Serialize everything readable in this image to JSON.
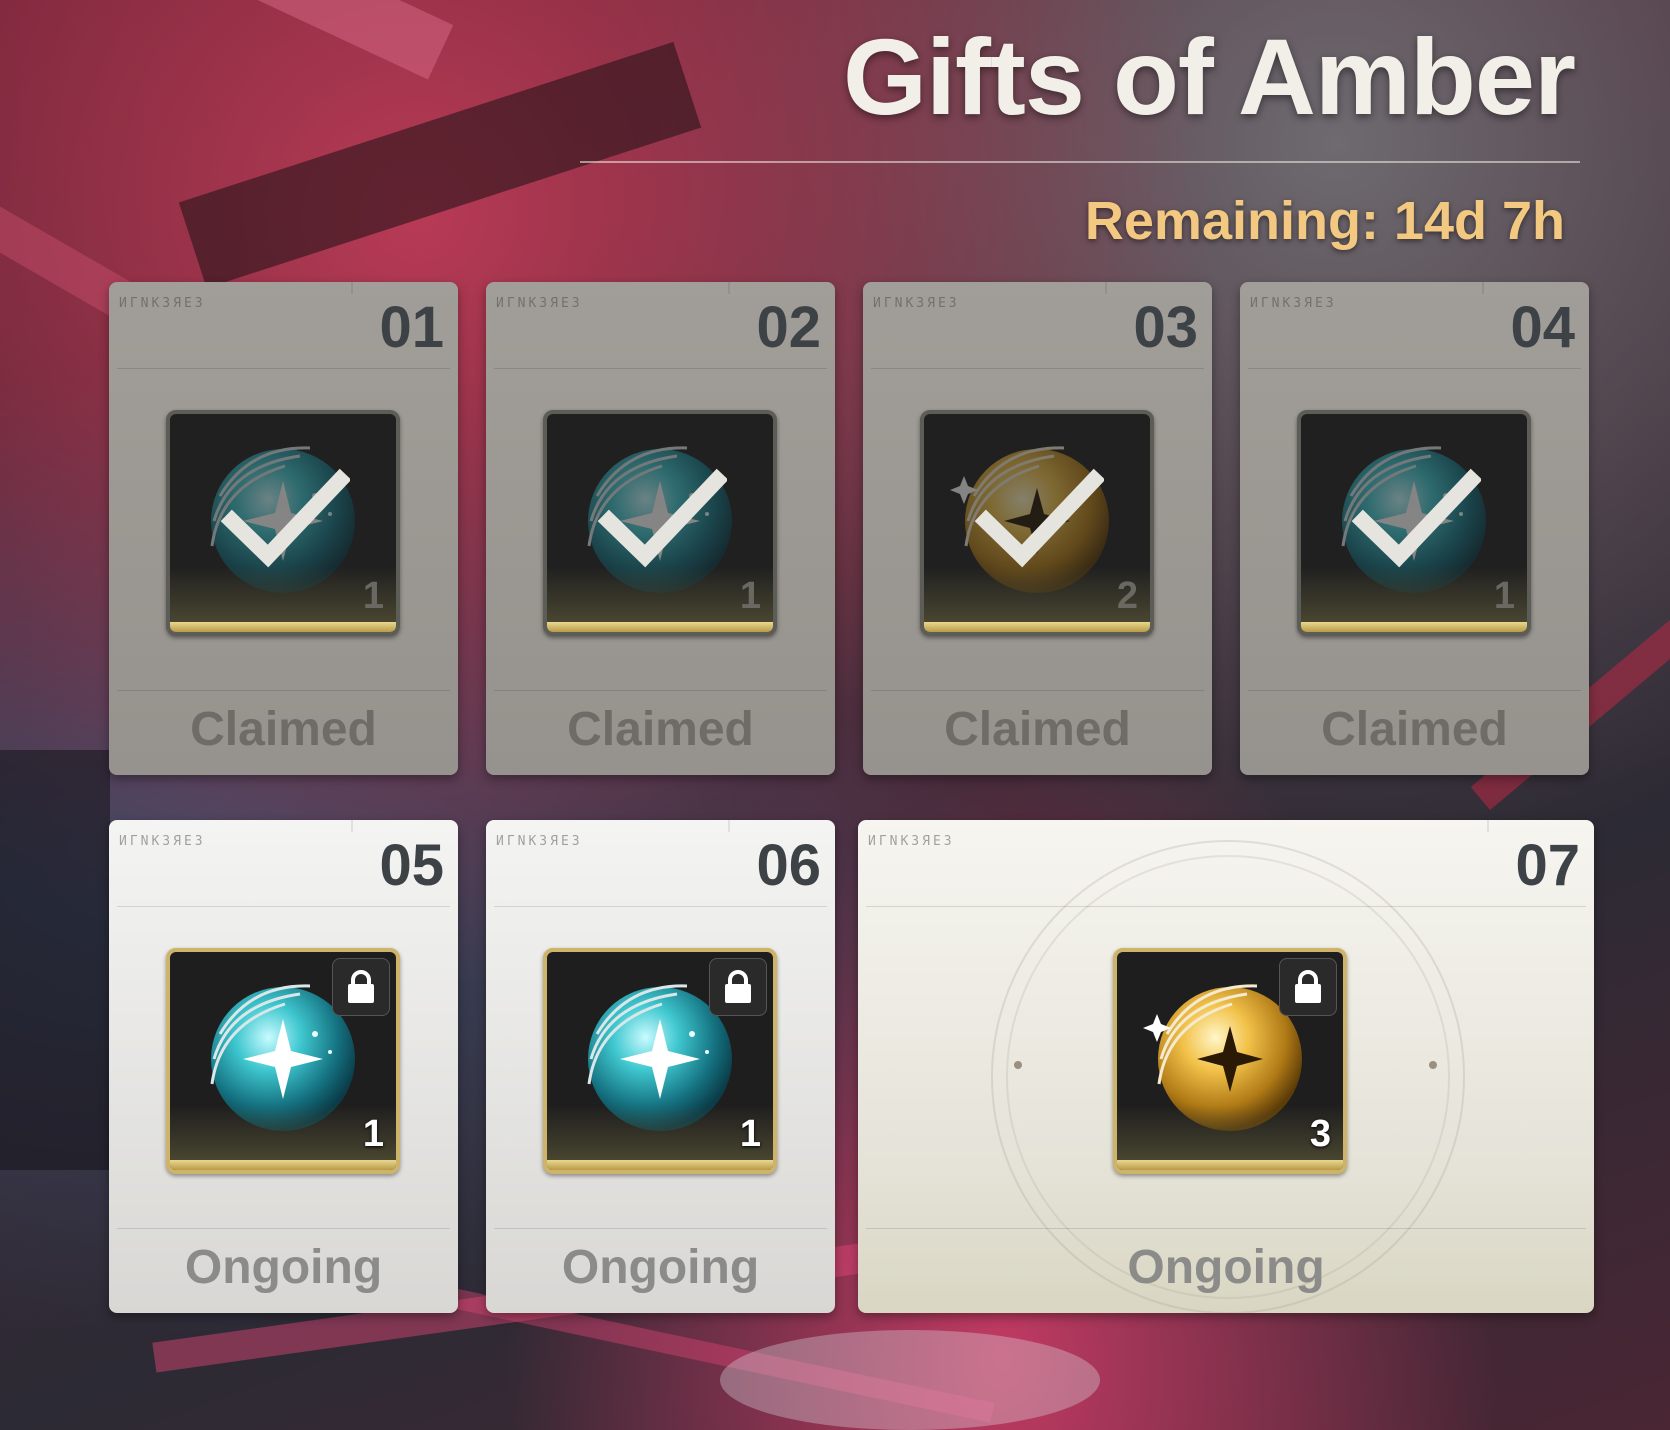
{
  "header": {
    "title": "Gifts of Amber",
    "remaining": "Remaining: 14d 7h"
  },
  "card_glyphs": "ИГNКЗЯЕЗ",
  "cards": [
    {
      "number": "01",
      "quantity": "1",
      "status": "Claimed",
      "orb": "teal-orb-icon"
    },
    {
      "number": "02",
      "quantity": "1",
      "status": "Claimed",
      "orb": "teal-orb-icon"
    },
    {
      "number": "03",
      "quantity": "2",
      "status": "Claimed",
      "orb": "gold-orb-icon"
    },
    {
      "number": "04",
      "quantity": "1",
      "status": "Claimed",
      "orb": "teal-orb-icon"
    },
    {
      "number": "05",
      "quantity": "1",
      "status": "Ongoing",
      "orb": "teal-orb-icon"
    },
    {
      "number": "06",
      "quantity": "1",
      "status": "Ongoing",
      "orb": "teal-orb-icon"
    },
    {
      "number": "07",
      "quantity": "3",
      "status": "Ongoing",
      "orb": "gold-orb-icon"
    }
  ],
  "colors": {
    "accent_remaining": "#f3c982",
    "claimed_card": "#9c9893",
    "ongoing_card": "#e9e8e5",
    "slot_gold": "#cdb46a"
  }
}
